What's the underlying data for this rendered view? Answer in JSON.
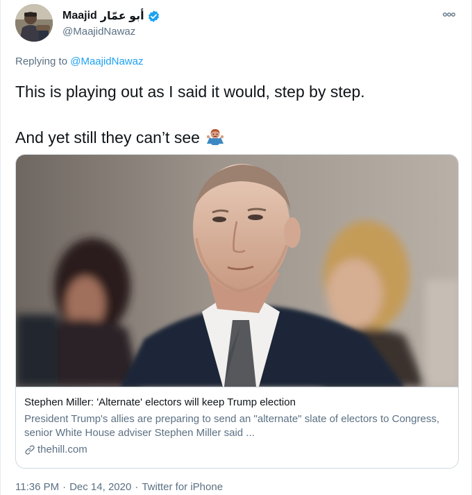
{
  "author": {
    "display_name": "Maajid",
    "display_name_arabic": "أبو عمّار",
    "handle": "@MaajidNawaz",
    "verified": true
  },
  "reply": {
    "prefix": "Replying to",
    "mention": "@MaajidNawaz"
  },
  "tweet": {
    "line1": "This is playing out as I said it would, step by step.",
    "line2": "And yet still they can’t see",
    "emoji": "man-shrugging-emoji"
  },
  "card": {
    "title": "Stephen Miller: 'Alternate' electors will keep Trump election",
    "description": "President Trump's allies are preparing to send an \"alternate\" slate of electors to Congress, senior White House adviser Stephen Miller said ...",
    "domain": "thehill.com"
  },
  "meta": {
    "time": "11:36 PM",
    "separator": "·",
    "date": "Dec 14, 2020",
    "source": "Twitter for iPhone"
  },
  "colors": {
    "accent": "#1da1f2",
    "secondary_text": "#5b7083",
    "border": "#cfd9de"
  },
  "icons": {
    "more": "more-icon",
    "verified": "verified-badge-icon",
    "link": "link-icon"
  }
}
